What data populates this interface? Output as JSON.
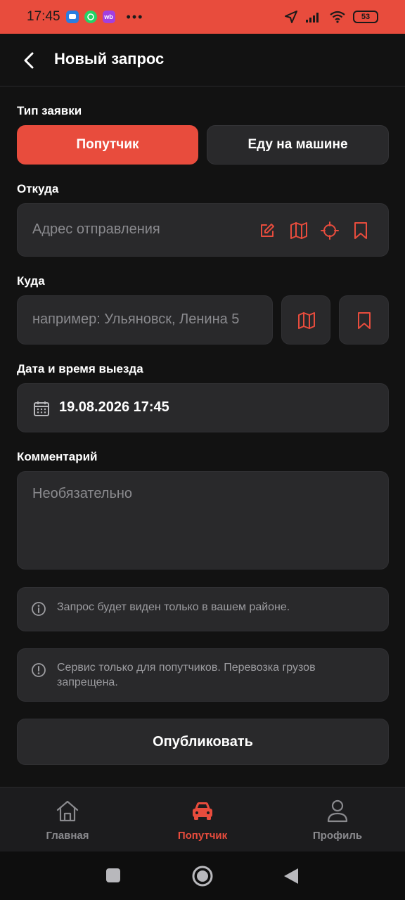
{
  "status_bar": {
    "time": "17:45",
    "apps": [
      "chat-app-icon",
      "whatsapp-icon",
      "wb-icon"
    ],
    "wb_label": "wb",
    "dots": "•••",
    "battery": "53"
  },
  "header": {
    "title": "Новый запрос"
  },
  "request_type": {
    "label": "Тип заявки",
    "options": [
      "Попутчик",
      "Еду на машине"
    ],
    "selected": "Попутчик"
  },
  "from": {
    "label": "Откуда",
    "placeholder": "Адрес отправления"
  },
  "to": {
    "label": "Куда",
    "placeholder": "например: Ульяновск, Ленина 5"
  },
  "datetime": {
    "label": "Дата и время выезда",
    "value": "19.08.2026 17:45"
  },
  "comment": {
    "label": "Комментарий",
    "placeholder": "Необязательно"
  },
  "notices": [
    "Запрос будет виден только в вашем районе.",
    "Сервис только для попутчиков. Перевозка грузов запрещена."
  ],
  "publish_label": "Опубликовать",
  "tabs": [
    {
      "label": "Главная",
      "icon": "home-icon",
      "active": false
    },
    {
      "label": "Попутчик",
      "icon": "car-icon",
      "active": true
    },
    {
      "label": "Профиль",
      "icon": "profile-icon",
      "active": false
    }
  ],
  "colors": {
    "accent": "#e84c3d",
    "background": "#121212",
    "card": "#29292b",
    "inactive_tab": "#8a8a8e"
  }
}
